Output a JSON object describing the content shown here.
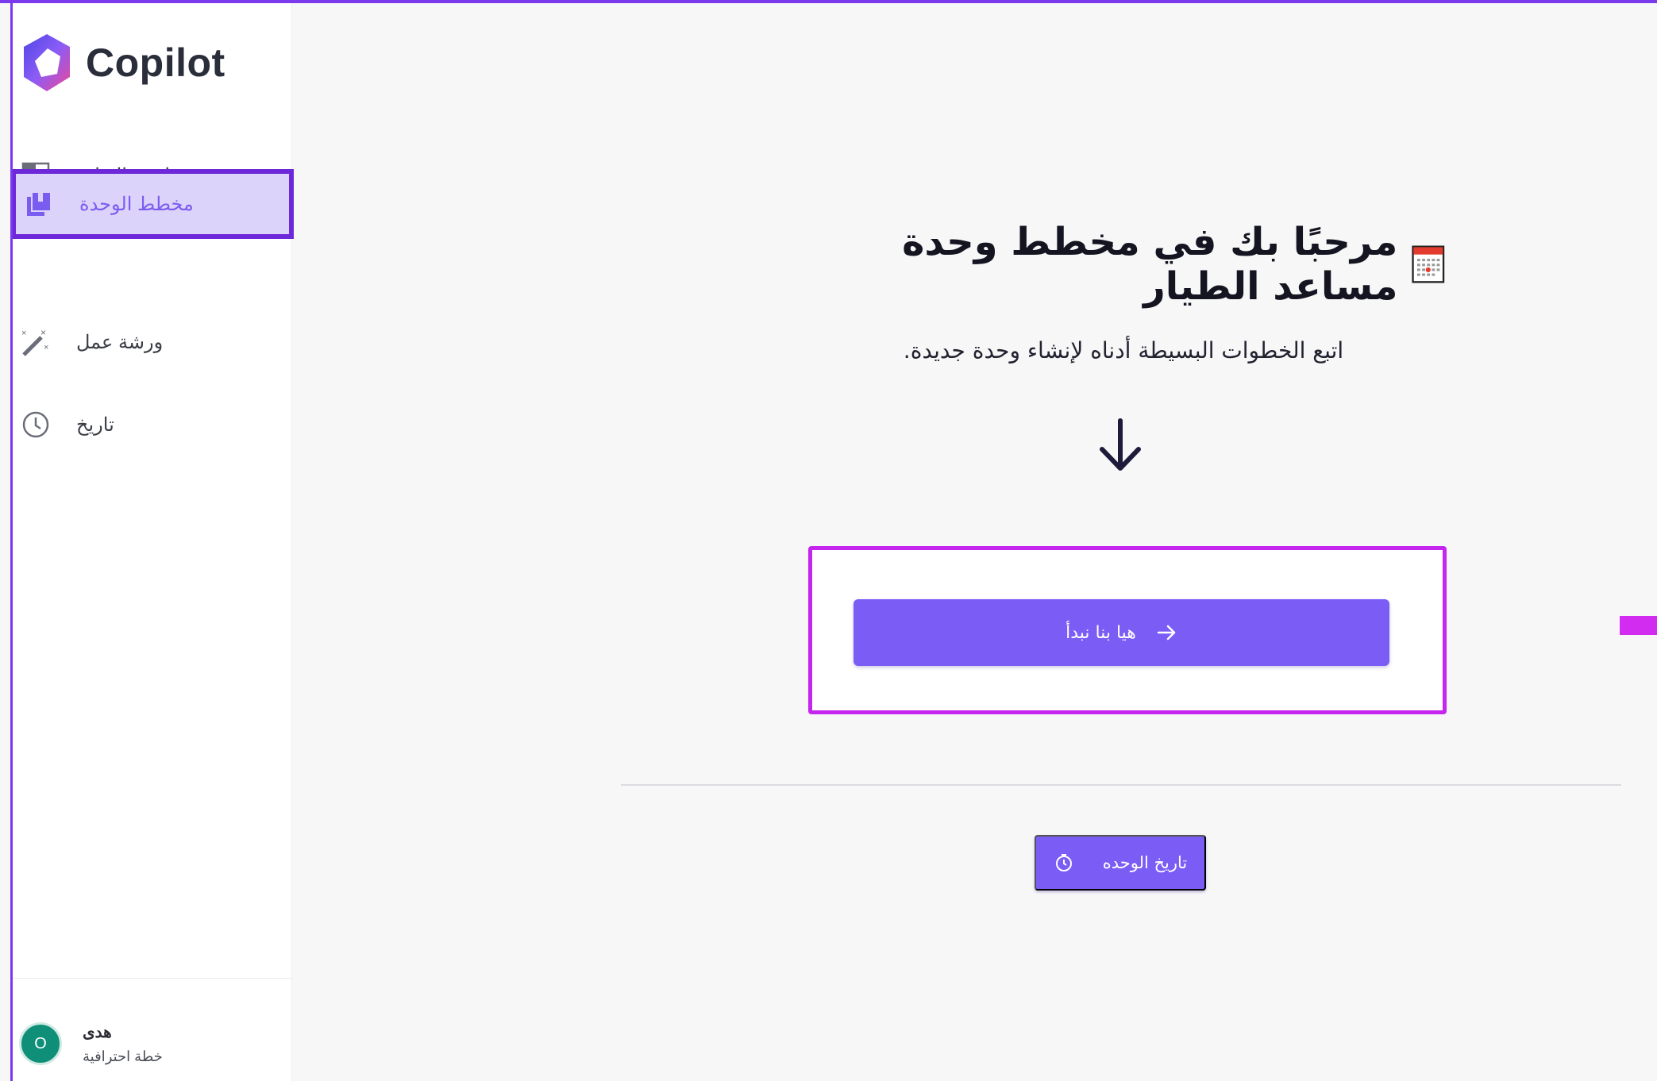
{
  "app": {
    "name": "Copilot"
  },
  "sidebar": {
    "items": [
      {
        "label": "لوحة القيادة",
        "icon": "dashboard-icon"
      },
      {
        "label": "مخطط الوحدة",
        "icon": "book-icon",
        "active": true
      },
      {
        "label": "ورشة عمل",
        "icon": "magic-wand-icon"
      },
      {
        "label": "تاريخ",
        "icon": "clock-icon"
      }
    ],
    "user": {
      "initial": "O",
      "name": "هدى",
      "plan": "خطة احترافية"
    }
  },
  "main": {
    "title": "مرحبًا بك في مخطط وحدة مساعد الطيار",
    "title_icon": "calendar-icon",
    "subtitle": ".اتبع الخطوات البسيطة أدناه لإنشاء وحدة جديدة",
    "start_button": "هيا بنا نبدأ",
    "history_button": "تاريخ الوحده"
  },
  "colors": {
    "accent": "#7b5cf5",
    "highlight_border": "#c526ef",
    "active_border": "#6d28d9",
    "active_bg": "#dcd3fb",
    "avatar": "#0f8f78"
  }
}
